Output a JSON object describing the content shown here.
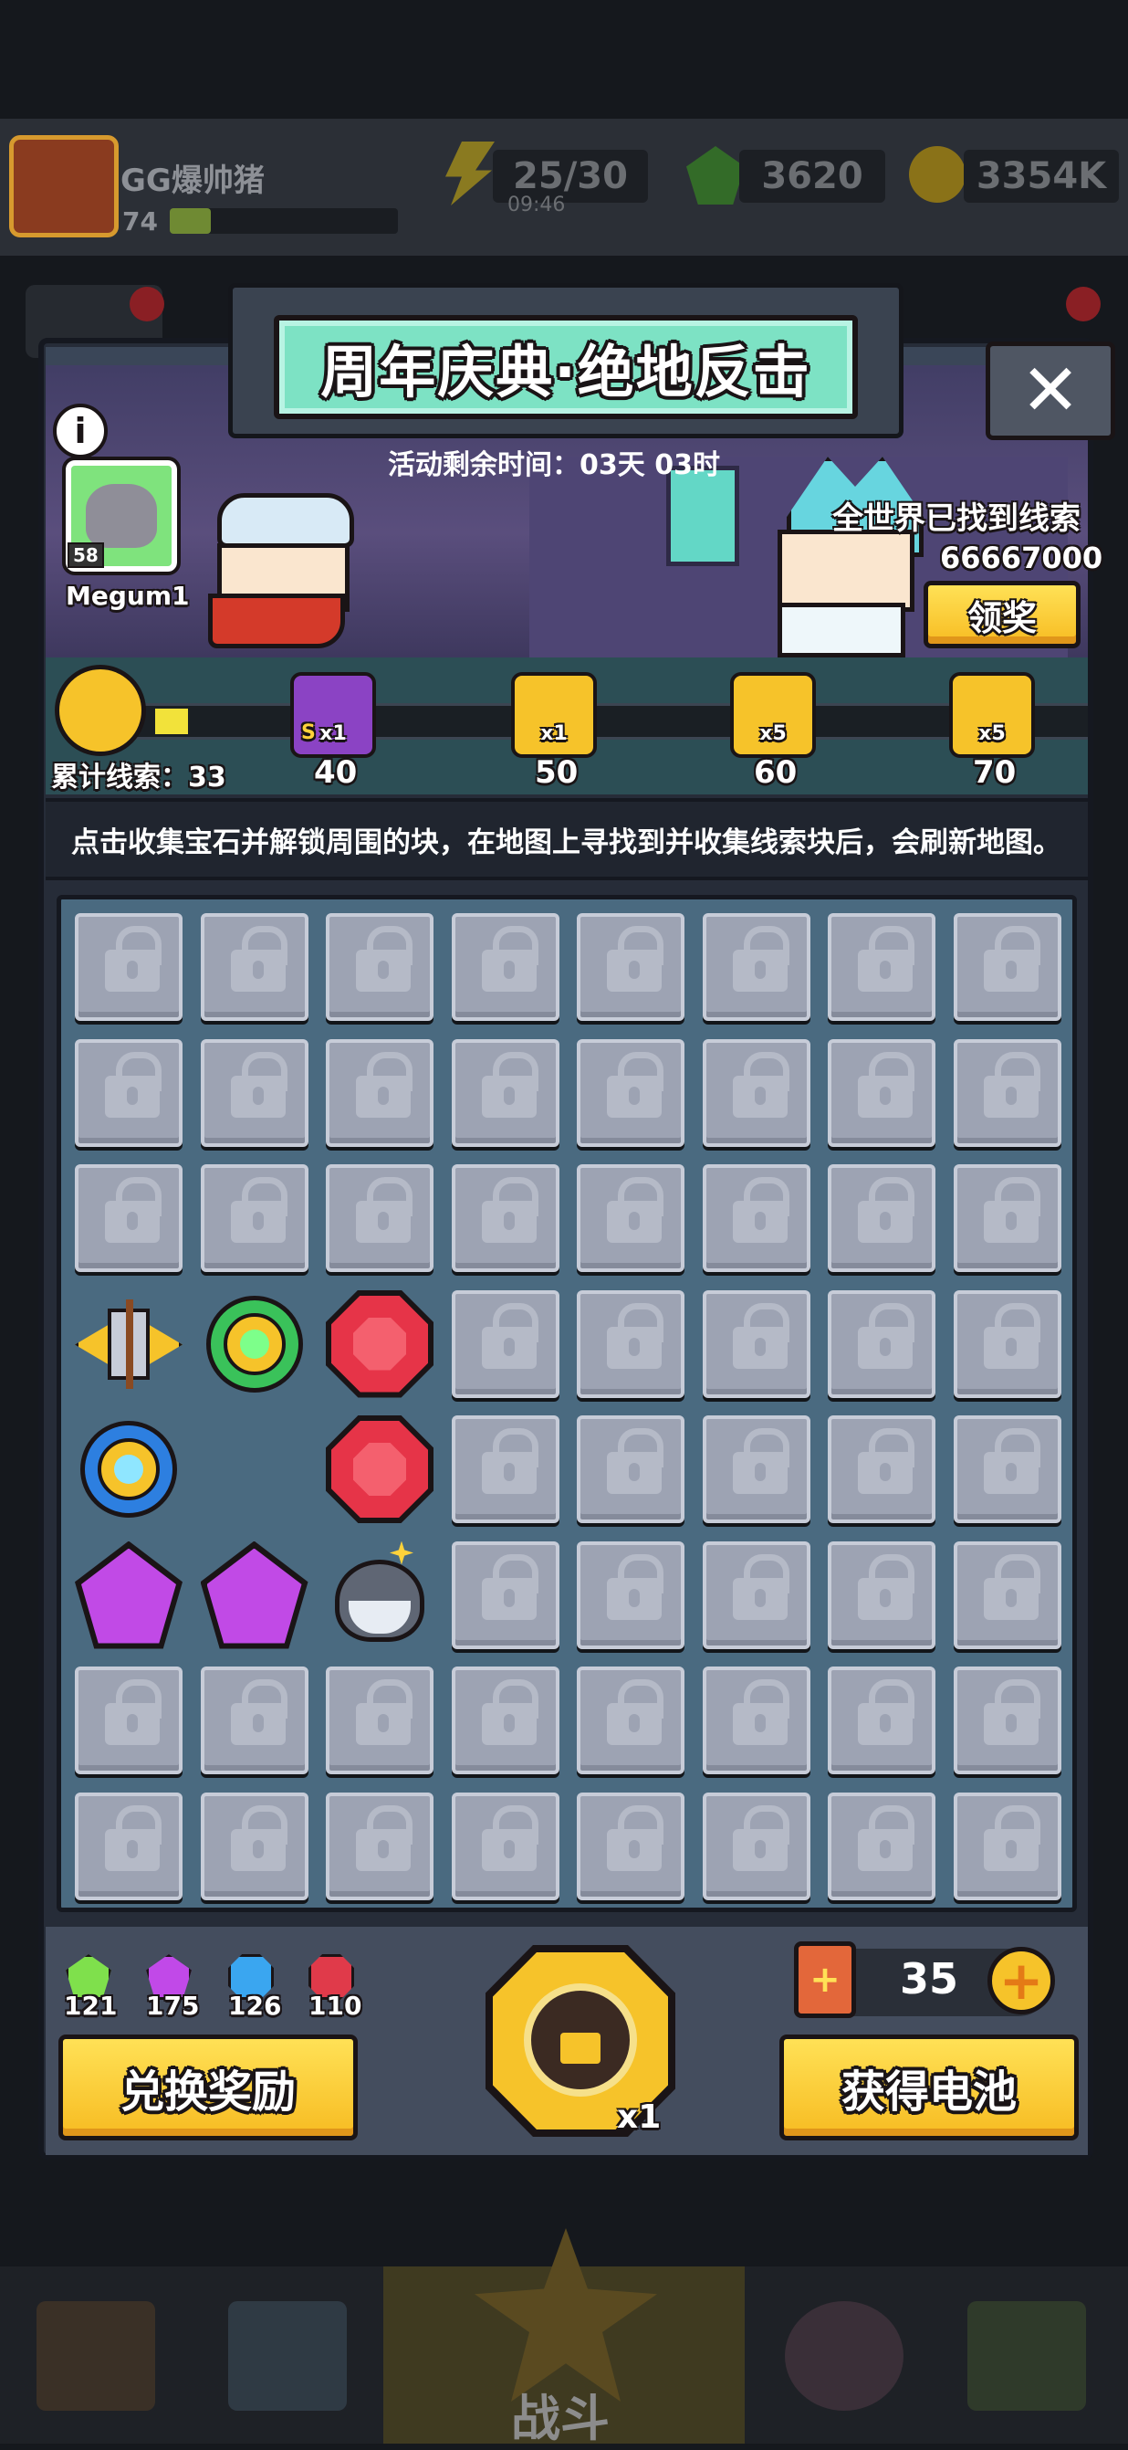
{
  "player": {
    "name": "GG爆帅猪",
    "level": "74"
  },
  "resources": {
    "energy": "25/30",
    "energy_timer": "09:46",
    "gems": "3620",
    "gold": "3354K"
  },
  "event": {
    "title": "周年庆典·绝地反击",
    "remaining_time": "活动剩余时间：03天 03时",
    "player_tag": "Megum1",
    "badge": "58",
    "world_clues_label": "全世界已找到线索",
    "world_clues_count": "66667000",
    "claim_label": "领奖",
    "total_clues": "累计线索：33",
    "milestones": [
      {
        "value": "40",
        "qty": "x1",
        "badge": "S"
      },
      {
        "value": "50",
        "qty": "x1"
      },
      {
        "value": "60",
        "qty": "x5"
      },
      {
        "value": "70",
        "qty": "x5"
      }
    ],
    "instructions": "点击收集宝石并解锁周围的块，在地图上寻找到并收集线索块后，会刷新地图。"
  },
  "gem_counts": {
    "green": "121",
    "purple": "175",
    "blue": "126",
    "red": "110"
  },
  "exchange_label": "兑换奖励",
  "unlock_qty": "x1",
  "battery_count": "35",
  "get_battery_label": "获得电池",
  "bottom_nav": {
    "battle_label": "战斗"
  },
  "colors": {
    "panel": "#262c38",
    "accent_yellow": "#f7c52a",
    "teal": "#7de2c4",
    "locked_tile": "#9da3b3"
  }
}
